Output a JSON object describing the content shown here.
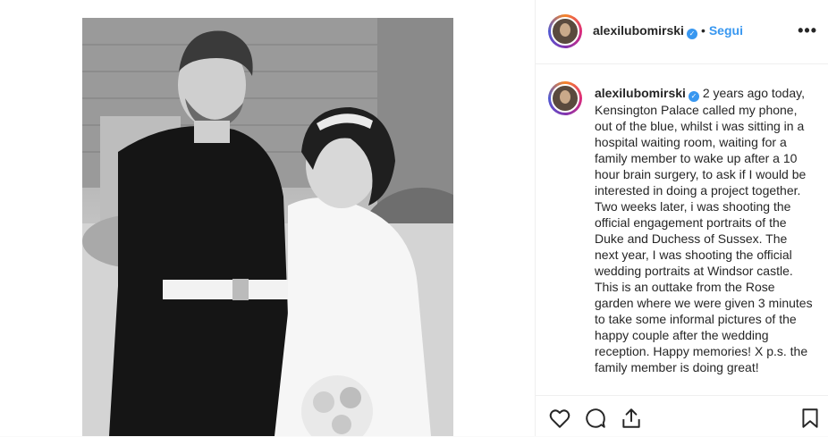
{
  "post": {
    "username": "alexilubomirski",
    "follow_label": "Segui",
    "separator": "•",
    "more_label": "•••",
    "caption": "2 years ago today, Kensington Palace called my phone, out of the blue, whilst i was sitting in a hospital waiting room, waiting for a family member to wake up after a 10 hour brain surgery, to ask if I would be interested in doing a project together. Two weeks later, i was shooting the official engagement portraits of the Duke and Duchess of Sussex. The next year, I was shooting the official wedding portraits at Windsor castle. This is an outtake from the Rose garden where we were given 3 minutes to take some informal pictures of the happy couple after the wedding reception. Happy memories! X p.s. the family member is doing great!"
  },
  "icons": {
    "verified": "verified-badge-icon",
    "like": "heart-icon",
    "comment": "comment-icon",
    "share": "share-icon",
    "save": "bookmark-icon"
  },
  "colors": {
    "accent": "#3897f0",
    "text": "#262626",
    "border": "#efefef"
  }
}
